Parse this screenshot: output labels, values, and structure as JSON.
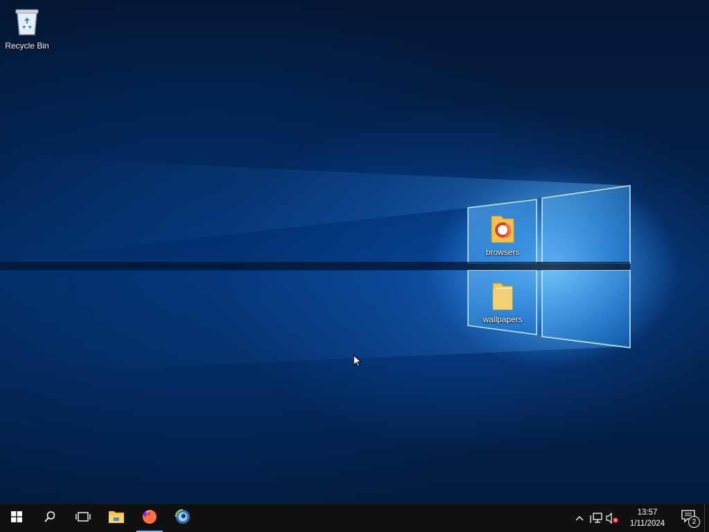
{
  "desktop": {
    "icons": [
      {
        "label": "Recycle Bin",
        "icon": "recycle-bin-icon"
      },
      {
        "label": "browsers",
        "icon": "folder-icon"
      },
      {
        "label": "wallpapers",
        "icon": "folder-icon"
      }
    ]
  },
  "taskbar": {
    "buttons": [
      {
        "icon": "windows-start-icon",
        "active": false
      },
      {
        "icon": "search-icon",
        "active": false
      },
      {
        "icon": "task-view-icon",
        "active": false
      },
      {
        "icon": "file-explorer-icon",
        "active": false
      },
      {
        "icon": "firefox-icon",
        "active": true
      },
      {
        "icon": "browser-globe-icon",
        "active": false
      }
    ],
    "tray": {
      "icons": [
        "chevron-up-icon",
        "network-icon",
        "volume-muted-icon"
      ],
      "time": "13:57",
      "date": "1/11/2024",
      "notification_count": "2"
    }
  },
  "colors": {
    "taskbar": "#101010",
    "active_indicator": "#76b9ed",
    "firefox_orange": "#ff7139"
  }
}
